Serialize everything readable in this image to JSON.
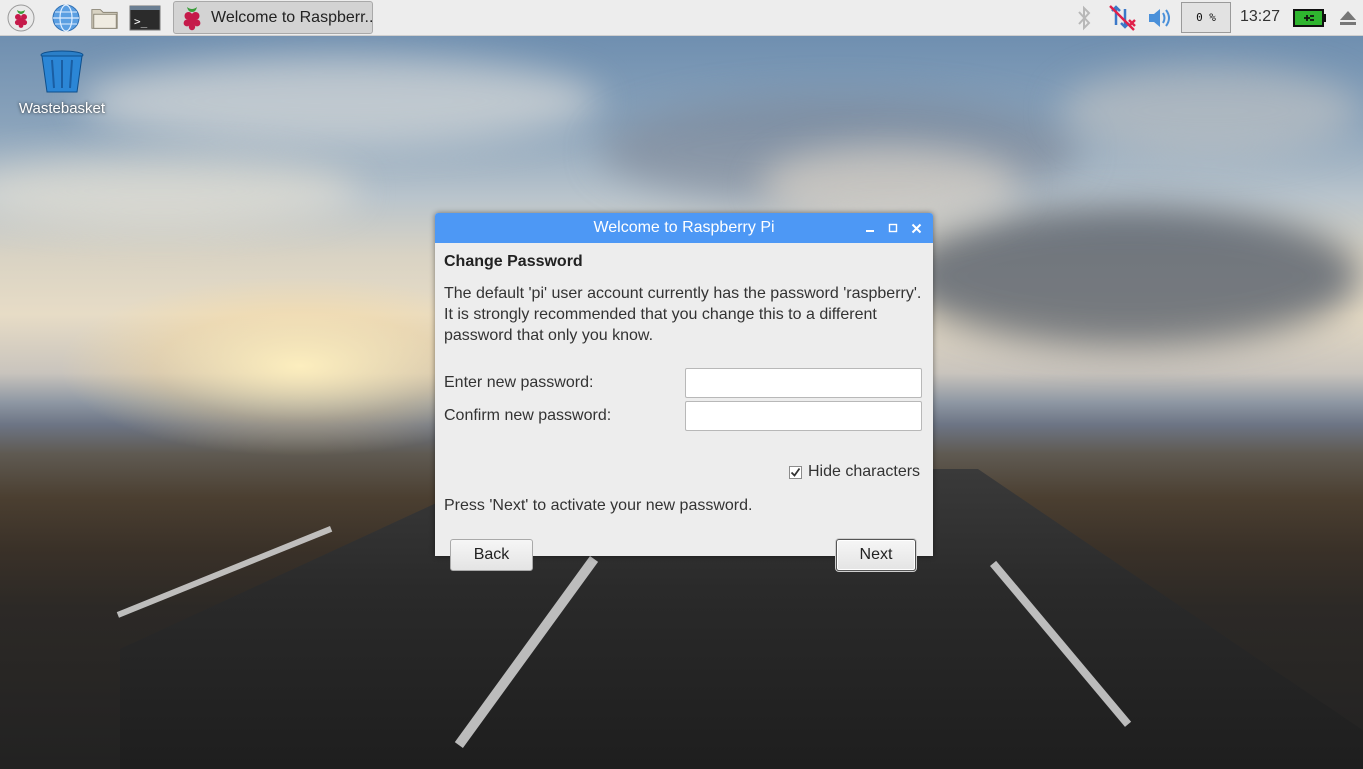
{
  "taskbar": {
    "launchers": [
      "raspberry-menu-icon",
      "web-browser-icon",
      "file-manager-icon",
      "terminal-icon"
    ],
    "task_label": "Welcome to Raspberr...",
    "tray": {
      "icons": [
        "bluetooth-icon",
        "network-disconnected-icon",
        "volume-icon"
      ],
      "cpu_usage": "0 %",
      "clock": "13:27",
      "battery_icon": "battery-charging-icon"
    }
  },
  "desktop": {
    "wastebasket_label": "Wastebasket"
  },
  "dialog": {
    "title": "Welcome to Raspberry Pi",
    "heading": "Change Password",
    "description_lines": [
      "The default 'pi' user account currently has the password 'raspberry'.",
      "It is strongly recommended that you change this to a different",
      "password that only you know."
    ],
    "new_password_label": "Enter new password:",
    "new_password_value": "",
    "confirm_password_label": "Confirm new password:",
    "confirm_password_value": "",
    "hide_characters_label": "Hide characters",
    "hide_characters_checked": true,
    "hint": "Press 'Next' to activate your new password.",
    "back_label": "Back",
    "next_label": "Next"
  },
  "colors": {
    "titlebar": "#4d98f5",
    "dialog_bg": "#ededed",
    "taskbar_bg": "#ededed",
    "battery": "#2fb52f"
  }
}
